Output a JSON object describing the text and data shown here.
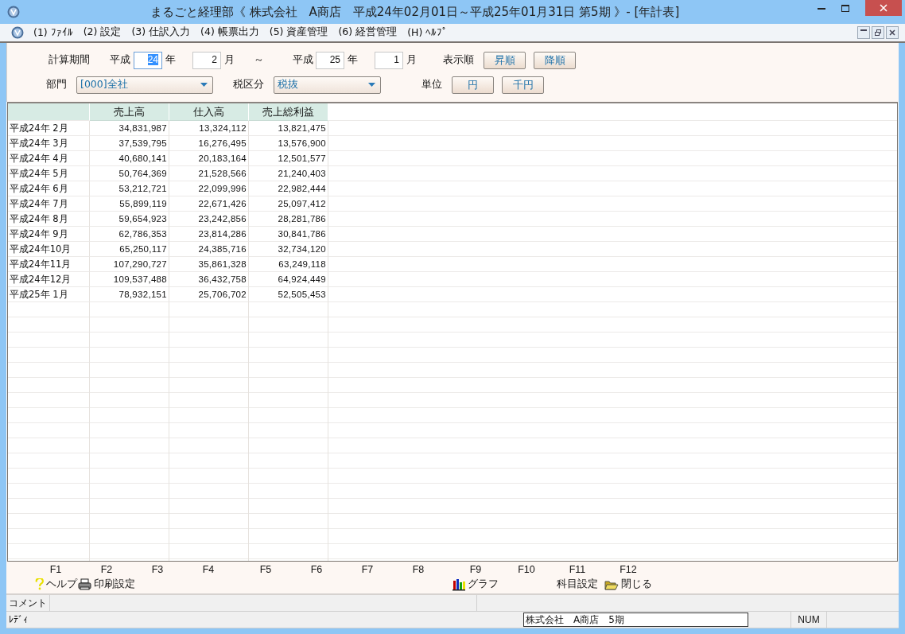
{
  "window": {
    "title": "まるごと経理部《 株式会社　A商店　平成24年02月01日～平成25年01月31日 第5期 》- [年計表]"
  },
  "menu": [
    "(1) ﾌｧｲﾙ",
    "(2) 設定",
    "(3) 仕訳入力",
    "(4) 帳票出力",
    "(5) 資産管理",
    "(6) 経営管理",
    "(H) ﾍﾙﾌﾟ"
  ],
  "form": {
    "period": {
      "label": "計算期間",
      "from": {
        "era": "平成",
        "year": {
          "value": "24",
          "focused": true
        },
        "year_unit": "年",
        "month": {
          "value": "2",
          "focused": false
        },
        "month_unit": "月"
      },
      "separator": "～",
      "to": {
        "era": "平成",
        "year": {
          "value": "25",
          "focused": false
        },
        "year_unit": "年",
        "month": {
          "value": "1",
          "focused": false
        },
        "month_unit": "月"
      }
    },
    "order": {
      "label": "表示順",
      "buttons": [
        "昇順",
        "降順"
      ]
    },
    "department": {
      "label": "部門",
      "value": "[000]全社"
    },
    "tax": {
      "label": "税区分",
      "value": "税抜"
    },
    "unit": {
      "label": "単位",
      "buttons": [
        "円",
        "千円"
      ]
    }
  },
  "table": {
    "columns": [
      "売上高",
      "仕入高",
      "売上総利益"
    ],
    "rows": [
      {
        "label": "平成24年 2月",
        "values": [
          "34,831,987",
          "13,324,112",
          "13,821,475"
        ]
      },
      {
        "label": "平成24年 3月",
        "values": [
          "37,539,795",
          "16,276,495",
          "13,576,900"
        ]
      },
      {
        "label": "平成24年 4月",
        "values": [
          "40,680,141",
          "20,183,164",
          "12,501,577"
        ]
      },
      {
        "label": "平成24年 5月",
        "values": [
          "50,764,369",
          "21,528,566",
          "21,240,403"
        ]
      },
      {
        "label": "平成24年 6月",
        "values": [
          "53,212,721",
          "22,099,996",
          "22,982,444"
        ]
      },
      {
        "label": "平成24年 7月",
        "values": [
          "55,899,119",
          "22,671,426",
          "25,097,412"
        ]
      },
      {
        "label": "平成24年 8月",
        "values": [
          "59,654,923",
          "23,242,856",
          "28,281,786"
        ]
      },
      {
        "label": "平成24年 9月",
        "values": [
          "62,786,353",
          "23,814,286",
          "30,841,786"
        ]
      },
      {
        "label": "平成24年10月",
        "values": [
          "65,250,117",
          "24,385,716",
          "32,734,120"
        ]
      },
      {
        "label": "平成24年11月",
        "values": [
          "107,290,727",
          "35,861,328",
          "63,249,118"
        ]
      },
      {
        "label": "平成24年12月",
        "values": [
          "109,537,488",
          "36,432,758",
          "64,924,449"
        ]
      },
      {
        "label": "平成25年 1月",
        "values": [
          "78,932,151",
          "25,706,702",
          "52,505,453"
        ]
      }
    ]
  },
  "function_keys": [
    {
      "key": "F1",
      "label": "ヘルプ",
      "kind": "help"
    },
    {
      "key": "F2",
      "label": "印刷設定",
      "kind": "print"
    },
    {
      "key": "F3"
    },
    {
      "key": "F4"
    },
    {
      "key": "F5"
    },
    {
      "key": "F6"
    },
    {
      "key": "F7"
    },
    {
      "key": "F8"
    },
    {
      "key": "F9",
      "label": "グラフ",
      "kind": "chart"
    },
    {
      "key": "F10"
    },
    {
      "key": "F11",
      "label": "科目設定",
      "kind": "plain"
    },
    {
      "key": "F12",
      "label": "閉じる",
      "kind": "folder"
    }
  ],
  "comment_bar": {
    "label": "コメント"
  },
  "status_bar": {
    "message": "ﾚﾃﾞｨ",
    "company": "株式会社　A商店　5期",
    "num": "NUM"
  }
}
